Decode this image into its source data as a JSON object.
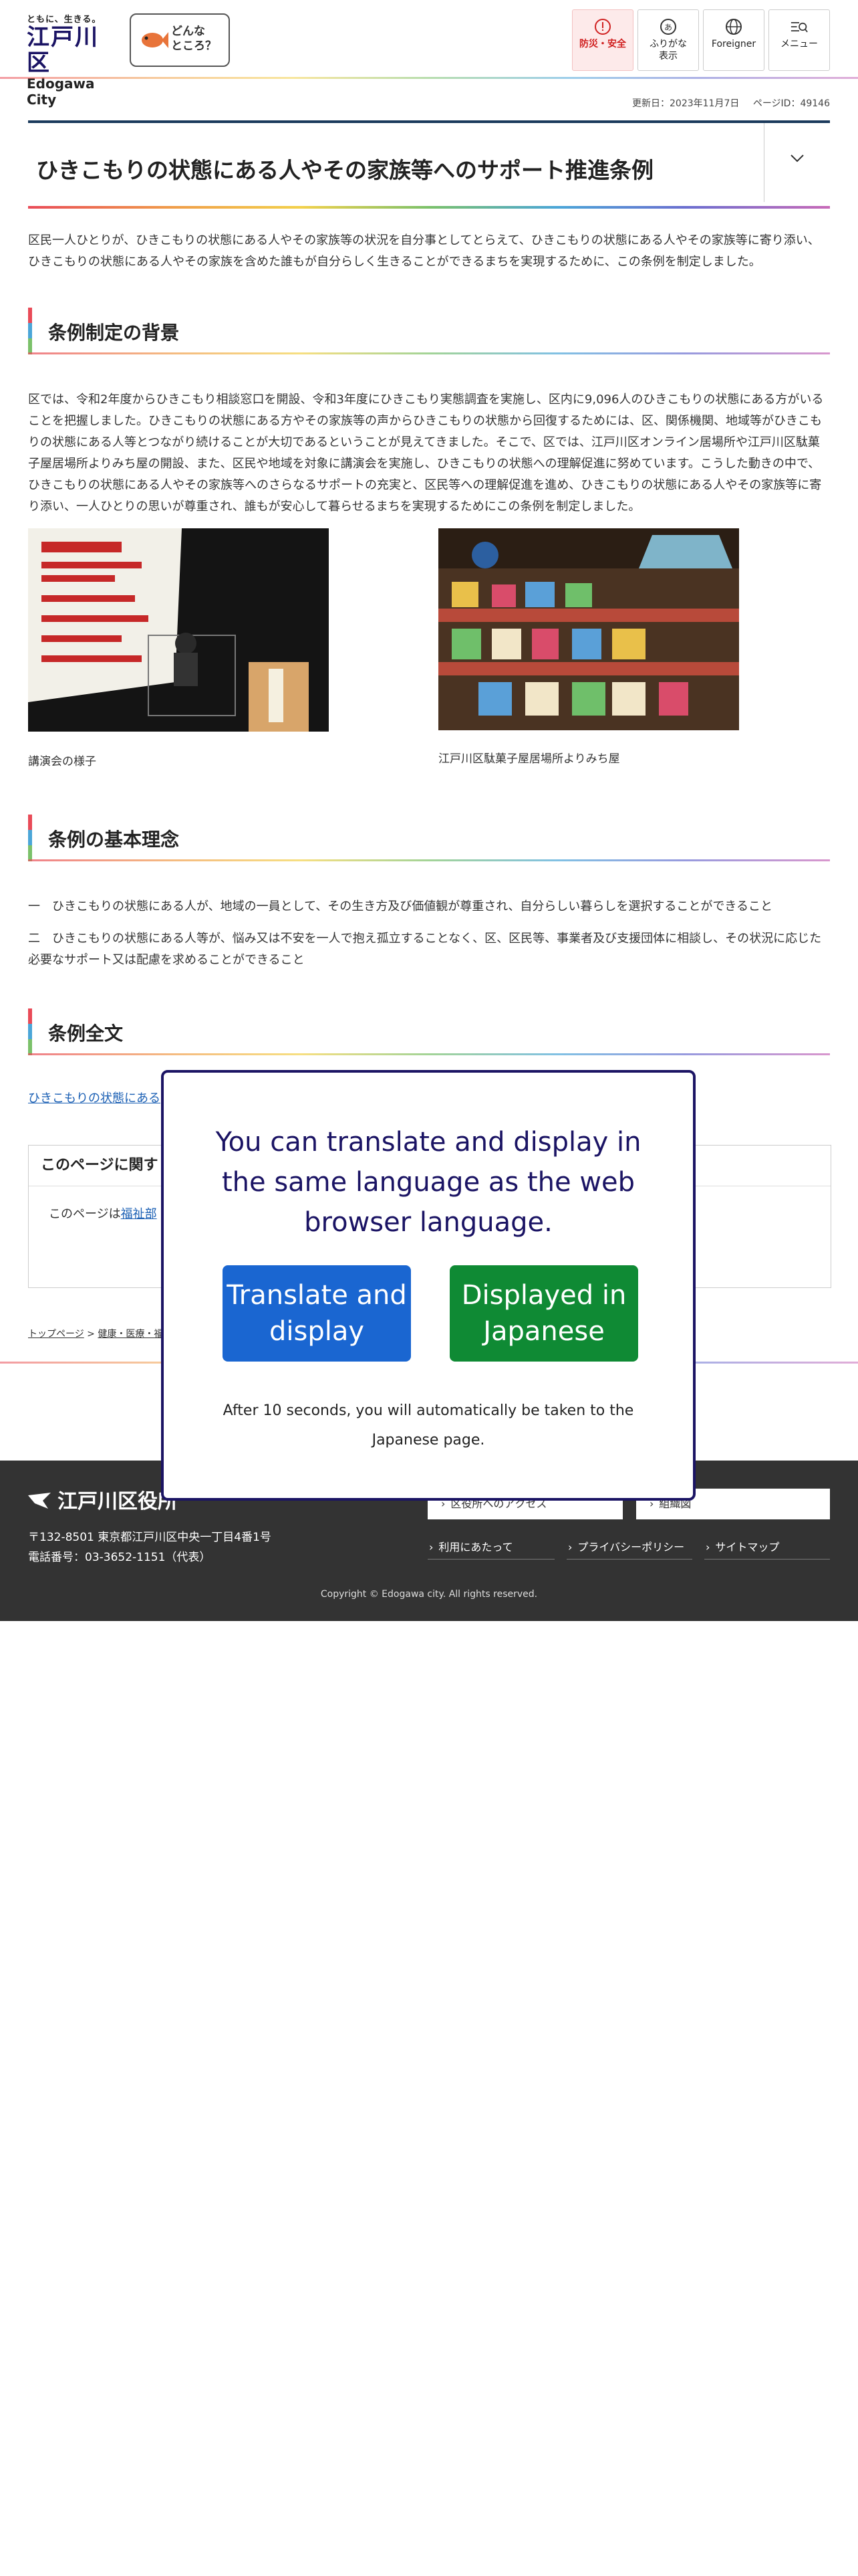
{
  "header": {
    "logo_tagline": "ともに、生きる。",
    "logo_kanji": "江戸川区",
    "logo_english": "Edogawa City",
    "donna_label_line1": "どんな",
    "donna_label_line2": "ところ？",
    "buttons": [
      {
        "label": "防災・安全",
        "icon": "alert-icon"
      },
      {
        "label": "ふりがな表示",
        "icon": "furigana-icon"
      },
      {
        "label": "Foreigner",
        "icon": "globe-icon"
      },
      {
        "label": "メニュー",
        "icon": "menu-search-icon"
      }
    ]
  },
  "meta": {
    "updated": "更新日：2023年11月7日",
    "page_id": "ページID：49146"
  },
  "title": "ひきこもりの状態にある人やその家族等へのサポート推進条例",
  "intro": "区民一人ひとりが、ひきこもりの状態にある人やその家族等の状況を自分事としてとらえて、ひきこもりの状態にある人やその家族等に寄り添い、ひきこもりの状態にある人やその家族を含めた誰もが自分らしく生きることができるまちを実現するために、この条例を制定しました。",
  "sections": {
    "background": {
      "heading": "条例制定の背景",
      "body": "区では、令和2年度からひきこもり相談窓口を開設、令和3年度にひきこもり実態調査を実施し、区内に9,096人のひきこもりの状態にある方がいることを把握しました。ひきこもりの状態にある方やその家族等の声からひきこもりの状態から回復するためには、区、関係機関、地域等がひきこもりの状態にある人等とつながり続けることが大切であるということが見えてきました。そこで、区では、江戸川区オンライン居場所や江戸川区駄菓子屋居場所よりみち屋の開設、また、区民や地域を対象に講演会を実施し、ひきこもりの状態への理解促進に努めています。こうした動きの中で、ひきこもりの状態にある人やその家族等へのさらなるサポートの充実と、区民等への理解促進を進め、ひきこもりの状態にある人やその家族等に寄り添い、一人ひとりの思いが尊重され、誰もが安心して暮らせるまちを実現するためにこの条例を制定しました。",
      "photo1_caption": "講演会の様子",
      "photo2_caption": "江戸川区駄菓子屋居場所よりみち屋"
    },
    "principles": {
      "heading": "条例の基本理念",
      "item1": "一　ひきこもりの状態にある人が、地域の一員として、その生き方及び価値観が尊重され、自分らしい暮らしを選択することができること",
      "item2": "二　ひきこもりの状態にある人等が、悩み又は不安を一人で抱え孤立することなく、区、区民等、事業者及び支援団体に相談し、その状況に応じた必要なサポート又は配慮を求めることができること"
    },
    "fulltext": {
      "heading": "条例全文",
      "link": "ひきこもりの状態にある"
    }
  },
  "inquiry": {
    "heading": "このページに関す",
    "body_prefix": "このページは",
    "body_link": "福祉部"
  },
  "breadcrumb": [
    "トップページ",
    "健康・医療・福"
  ],
  "footer": {
    "name": "江戸川区役所",
    "address": "〒132-8501 東京都江戸川区中央一丁目4番1号",
    "phone": "電話番号：03-3652-1151（代表）",
    "btn_access": "区役所へのアクセス",
    "btn_org": "組織図",
    "link_terms": "利用にあたって",
    "link_privacy": "プライバシーポリシー",
    "link_sitemap": "サイトマップ",
    "copyright": "Copyright © Edogawa city. All rights reserved."
  },
  "modal": {
    "message": "You can translate and display in the same language as the web browser language.",
    "translate_button": "Translate and display",
    "japanese_button": "Displayed in Japanese",
    "note": "After 10 seconds, you will automatically be taken to the Japanese page."
  },
  "colors": {
    "brand_navy": "#1b1464",
    "translate_blue": "#1a66d1",
    "japanese_green": "#0f8a34",
    "footer_bg": "#333333"
  }
}
